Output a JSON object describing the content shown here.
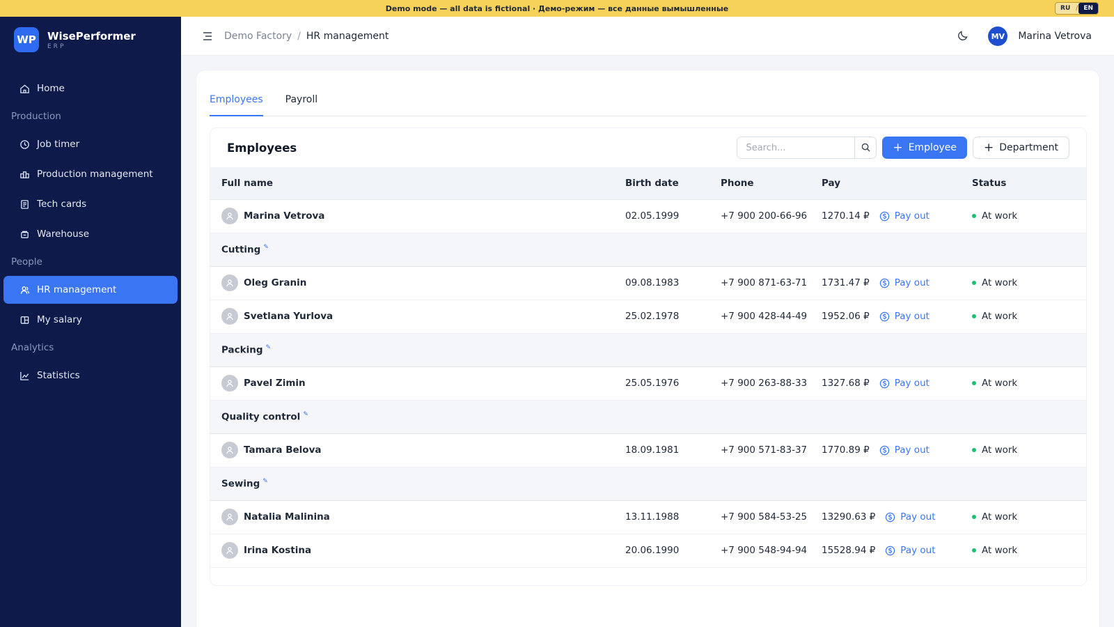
{
  "banner": {
    "text": "Demo mode — all data is fictional · Демо-режим — все данные вымышленные",
    "lang_ru": "RU",
    "lang_sep": "/",
    "lang_en": "EN"
  },
  "brand": {
    "logo": "WP",
    "name": "WisePerformer",
    "sub": "ERP"
  },
  "sidebar": {
    "home": "Home",
    "section_production": "Production",
    "job_timer": "Job timer",
    "production_management": "Production management",
    "tech_cards": "Tech cards",
    "warehouse": "Warehouse",
    "section_people": "People",
    "hr_management": "HR management",
    "my_salary": "My salary",
    "section_analytics": "Analytics",
    "statistics": "Statistics"
  },
  "topbar": {
    "breadcrumb_root": "Demo Factory",
    "breadcrumb_sep": "/",
    "breadcrumb_current": "HR management",
    "avatar_initials": "MV",
    "user_name": "Marina Vetrova"
  },
  "tabs": {
    "employees": "Employees",
    "payroll": "Payroll"
  },
  "panel": {
    "title": "Employees",
    "search_placeholder": "Search...",
    "add_employee": "Employee",
    "add_department": "Department"
  },
  "table": {
    "headers": {
      "name": "Full name",
      "birth": "Birth date",
      "phone": "Phone",
      "pay": "Pay",
      "status": "Status"
    },
    "payout_label": "Pay out",
    "rows": [
      {
        "name": "Marina Vetrova",
        "birth": "02.05.1999",
        "phone": "+7 900 200-66-96",
        "pay": "1270.14 ₽",
        "status": "At work"
      },
      {
        "group": "Cutting"
      },
      {
        "name": "Oleg Granin",
        "birth": "09.08.1983",
        "phone": "+7 900 871-63-71",
        "pay": "1731.47 ₽",
        "status": "At work"
      },
      {
        "name": "Svetlana Yurlova",
        "birth": "25.02.1978",
        "phone": "+7 900 428-44-49",
        "pay": "1952.06 ₽",
        "status": "At work"
      },
      {
        "group": "Packing"
      },
      {
        "name": "Pavel Zimin",
        "birth": "25.05.1976",
        "phone": "+7 900 263-88-33",
        "pay": "1327.68 ₽",
        "status": "At work"
      },
      {
        "group": "Quality control"
      },
      {
        "name": "Tamara Belova",
        "birth": "18.09.1981",
        "phone": "+7 900 571-83-37",
        "pay": "1770.89 ₽",
        "status": "At work"
      },
      {
        "group": "Sewing"
      },
      {
        "name": "Natalia Malinina",
        "birth": "13.11.1988",
        "phone": "+7 900 584-53-25",
        "pay": "13290.63 ₽",
        "status": "At work"
      },
      {
        "name": "Irina Kostina",
        "birth": "20.06.1990",
        "phone": "+7 900 548-94-94",
        "pay": "15528.94 ₽",
        "status": "At work"
      }
    ]
  },
  "colors": {
    "accent": "#3a76f4",
    "sidebar_bg": "#0e1a4a",
    "banner_bg": "#f7d25a",
    "status_ok": "#1fbf73"
  }
}
